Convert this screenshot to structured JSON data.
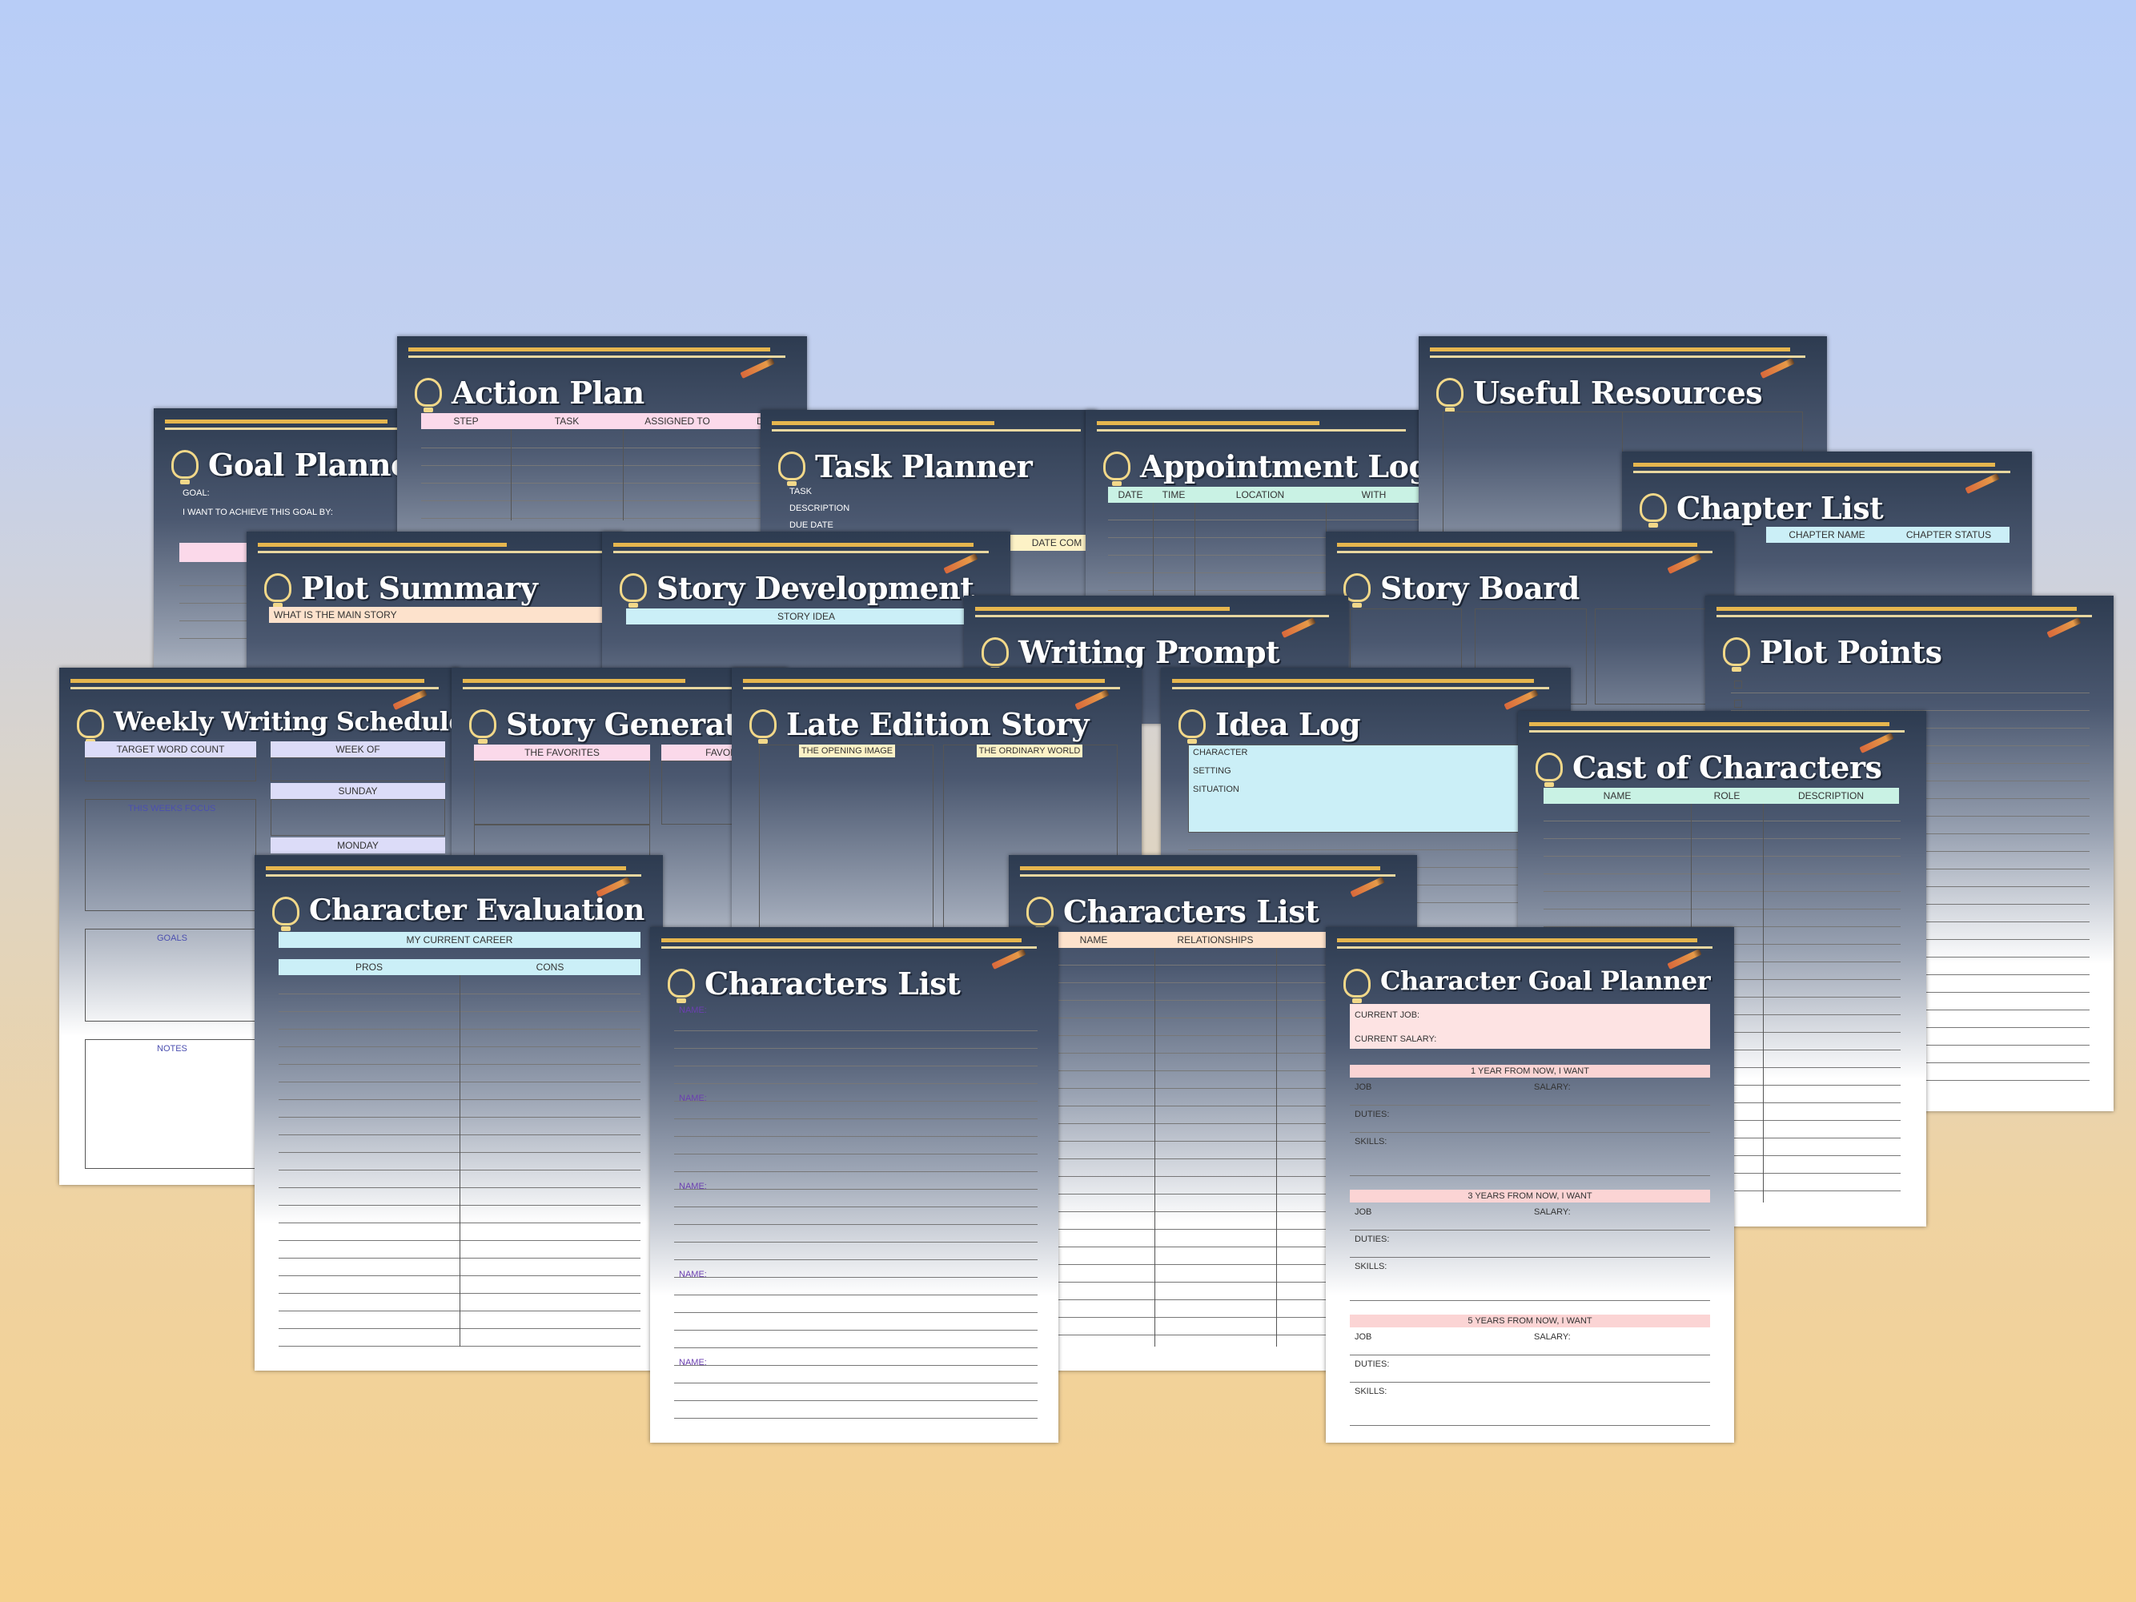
{
  "sheets": {
    "goal_planner": {
      "title": "Goal Planner",
      "goal": "GOAL:",
      "achieve_by": "I WANT TO ACHIEVE THIS GOAL BY:"
    },
    "action_plan": {
      "title": "Action Plan",
      "cols": [
        "STEP",
        "TASK",
        "ASSIGNED TO",
        "DO"
      ]
    },
    "task_planner": {
      "title": "Task Planner",
      "task": "TASK",
      "description": "DESCRIPTION",
      "due_date": "DUE DATE",
      "date_com": "DATE COM"
    },
    "appointment_log": {
      "title": "Appointment Log",
      "cols": [
        "DATE",
        "TIME",
        "LOCATION",
        "WITH"
      ]
    },
    "useful_resources": {
      "title": "Useful Resources"
    },
    "chapter_list": {
      "title": "Chapter List",
      "cols": [
        "CHAPTER NAME",
        "CHAPTER STATUS"
      ]
    },
    "plot_summary": {
      "title": "Plot Summary",
      "main_story": "WHAT IS THE MAIN STORY"
    },
    "story_development": {
      "title": "Story Development",
      "story_idea": "STORY IDEA"
    },
    "story_board": {
      "title": "Story Board"
    },
    "writing_prompt": {
      "title": "Writing Prompt"
    },
    "plot_points": {
      "title": "Plot Points"
    },
    "weekly_writing_schedule": {
      "title": "Weekly Writing Schedule",
      "target": "TARGET WORD COUNT",
      "week_of": "WEEK OF",
      "sunday": "SUNDAY",
      "focus": "THIS WEEKS FOCUS",
      "monday": "MONDAY",
      "goals": "GOALS",
      "notes": "NOTES"
    },
    "story_generator": {
      "title": "Story Generator",
      "favorites": "THE FAVORITES",
      "favor": "FAVOR"
    },
    "late_edition_story": {
      "title": "Late Edition Story",
      "opening": "THE OPENING IMAGE",
      "ordinary": "THE ORDINARY WORLD"
    },
    "idea_log": {
      "title": "Idea Log",
      "character": "CHARACTER",
      "setting": "SETTING",
      "situation": "SITUATION"
    },
    "cast_of_characters": {
      "title": "Cast of Characters",
      "cols": [
        "NAME",
        "ROLE",
        "DESCRIPTION"
      ]
    },
    "character_evaluation": {
      "title": "Character Evaluation",
      "career": "MY CURRENT CAREER",
      "pros": "PROS",
      "cons": "CONS"
    },
    "characters_list_a": {
      "title": "Characters List",
      "cols": [
        "NAME",
        "RELATIONSHIPS",
        "N"
      ]
    },
    "characters_list_b": {
      "title": "Characters List",
      "name": "NAME:"
    },
    "character_goal_planner": {
      "title": "Character Goal Planner",
      "current_job": "CURRENT JOB:",
      "current_salary": "CURRENT SALARY:",
      "y1": "1 YEAR FROM NOW, I WANT",
      "y3": "3 YEARS FROM NOW, I WANT",
      "y5": "5 YEARS FROM NOW, I WANT",
      "job": "JOB",
      "salary": "SALARY:",
      "duties": "DUTIES:",
      "skills": "SKILLS:"
    }
  }
}
